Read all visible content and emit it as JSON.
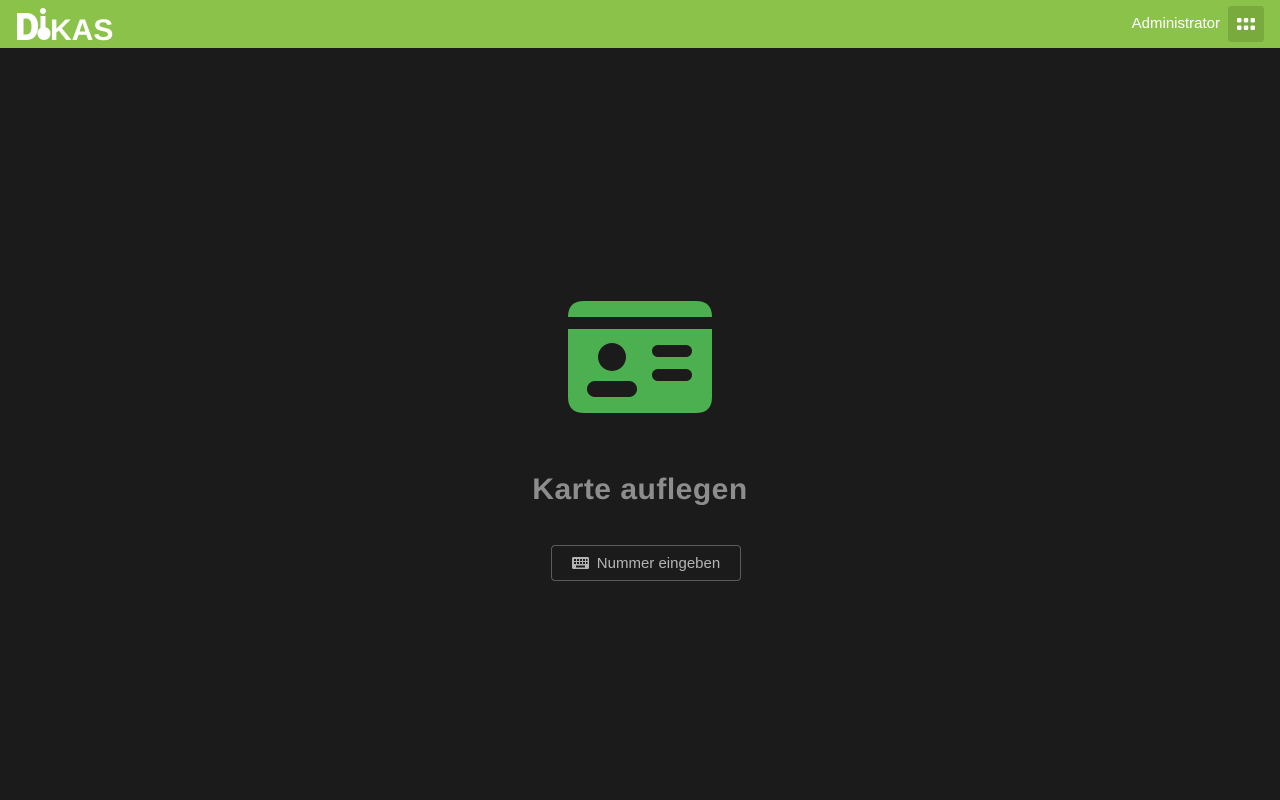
{
  "header": {
    "logo_text": "DIKAS",
    "user_name": "Administrator",
    "apps_icon": "grid-icon",
    "color": "#8bc34a"
  },
  "main": {
    "icon": "id-card-icon",
    "icon_color": "#4caf50",
    "prompt": "Karte auflegen",
    "enter_number_button": {
      "icon": "keyboard-icon",
      "label": "Nummer eingeben"
    }
  }
}
